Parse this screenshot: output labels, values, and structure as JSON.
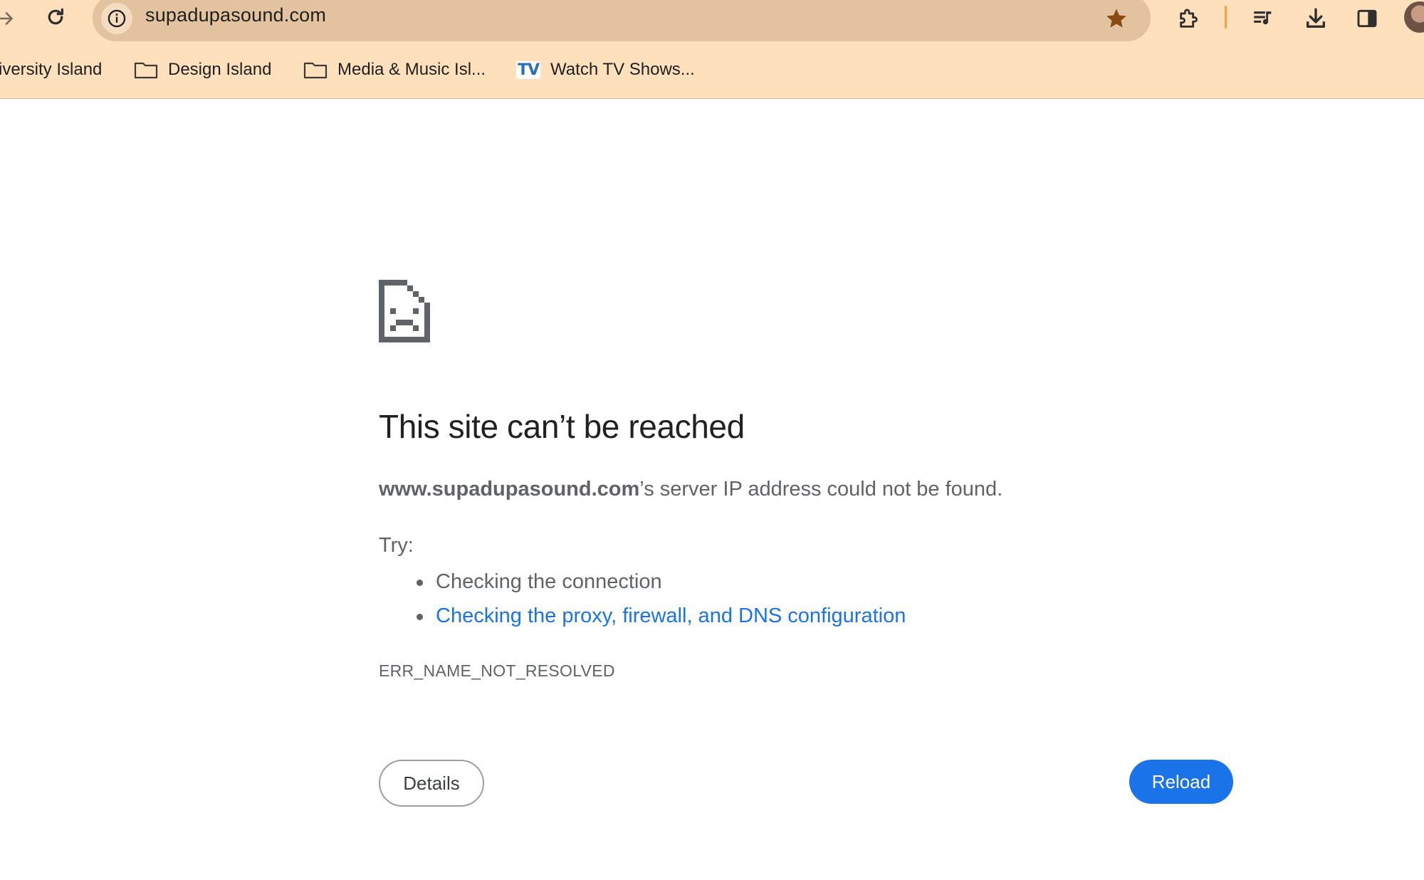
{
  "omnibox": {
    "url": "supadupasound.com"
  },
  "bookmarks": [
    {
      "label": "iversity Island",
      "icon": "none"
    },
    {
      "label": "Design Island",
      "icon": "folder-icon"
    },
    {
      "label": "Media & Music Isl...",
      "icon": "folder-icon"
    },
    {
      "label": "Watch TV Shows...",
      "icon": "tv-icon",
      "icon_text": "TV"
    }
  ],
  "colors": {
    "chrome_bg": "#fee0bd",
    "omnibox_bg": "#e3c39f",
    "star": "#8b4a10",
    "link": "#1a73e8",
    "reload_bg": "#1a73e8",
    "text_muted": "#5f6368",
    "title": "#202124"
  },
  "error": {
    "title": "This site can’t be reached",
    "host": "www.supadupasound.com",
    "message_suffix": "’s server IP address could not be found.",
    "try_label": "Try:",
    "suggestions": [
      {
        "text": "Checking the connection",
        "is_link": false
      },
      {
        "text": "Checking the proxy, firewall, and DNS configuration",
        "is_link": true
      }
    ],
    "code": "ERR_NAME_NOT_RESOLVED",
    "details_label": "Details",
    "reload_label": "Reload"
  }
}
